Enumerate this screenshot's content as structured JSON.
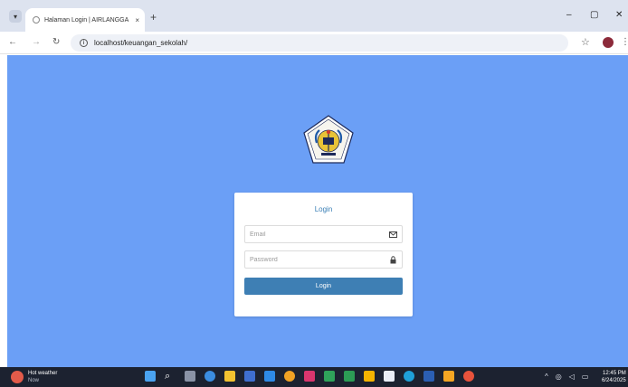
{
  "browser": {
    "tab_title": "Halaman Login | AIRLANGGA",
    "tab_close": "×",
    "new_tab": "+",
    "url": "localhost/keuangan_sekolah/"
  },
  "login": {
    "title": "Login",
    "email_placeholder": "Email",
    "password_placeholder": "Password",
    "button_label": "Login"
  },
  "taskbar": {
    "weather_title": "Hot weather",
    "weather_sub": "Now",
    "time": "12:45 PM",
    "date": "6/24/2025"
  },
  "colors": {
    "page_background": "#6b9ff6",
    "button": "#3e7fb4",
    "title": "#3a7fb6",
    "taskbar": "#1c2230"
  },
  "icons": {
    "email_field": "envelope-icon",
    "password_field": "lock-icon"
  }
}
